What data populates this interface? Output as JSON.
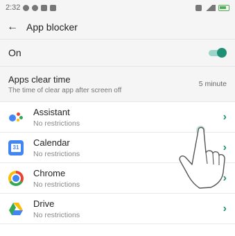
{
  "status_bar": {
    "time": "2:32"
  },
  "app_bar": {
    "back_icon": "arrow-left",
    "title": "App blocker"
  },
  "toggle_row": {
    "label": "On",
    "enabled": true,
    "accent": "#1f8f75"
  },
  "clear_time": {
    "title": "Apps clear time",
    "subtitle": "The time of clear app after screen off",
    "value": "5 minute"
  },
  "apps": [
    {
      "name": "Assistant",
      "status": "No restrictions",
      "icon": "assistant-icon"
    },
    {
      "name": "Calendar",
      "status": "No restrictions",
      "icon": "calendar-icon",
      "icon_text": "31"
    },
    {
      "name": "Chrome",
      "status": "No restrictions",
      "icon": "chrome-icon"
    },
    {
      "name": "Drive",
      "status": "No restrictions",
      "icon": "drive-icon"
    }
  ],
  "chevron": "›"
}
